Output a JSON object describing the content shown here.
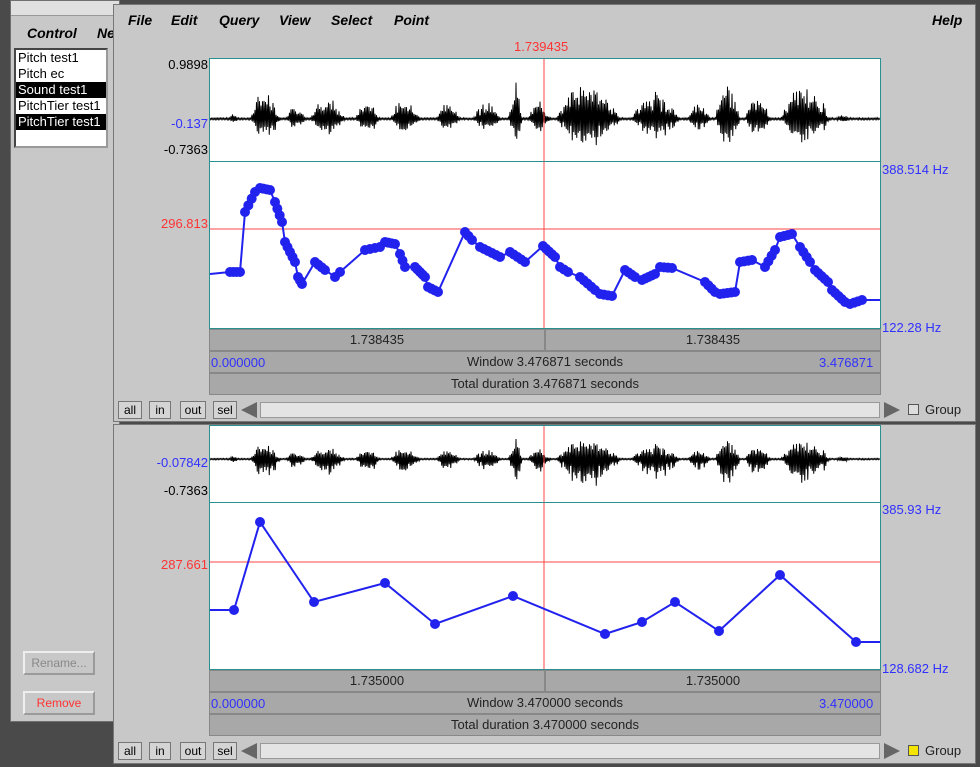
{
  "object_window": {
    "menu": [
      "Control",
      "Ne"
    ],
    "objects": [
      {
        "label": "Pitch test1",
        "selected": false
      },
      {
        "label": "Pitch ec",
        "selected": false
      },
      {
        "label": "Sound test1",
        "selected": true
      },
      {
        "label": "PitchTier test1",
        "selected": false
      },
      {
        "label": "PitchTier test1",
        "selected": true
      }
    ],
    "rename_label": "Rename...",
    "remove_label": "Remove"
  },
  "editor1": {
    "menu": [
      "File",
      "Edit",
      "Query",
      "View",
      "Select",
      "Point"
    ],
    "help": "Help",
    "cursor_time": "1.739435",
    "sound_max": "0.9898",
    "sound_mid": "-0.137",
    "sound_min": "-0.7363",
    "pitch_top": "388.514 Hz",
    "pitch_bottom": "122.28 Hz",
    "pitch_cursor": "296.813",
    "left_half": "1.738435",
    "right_half": "1.738435",
    "window_start": "0.000000",
    "window_text": "Window 3.476871 seconds",
    "window_end": "3.476871",
    "total_text": "Total duration 3.476871 seconds",
    "buttons": [
      "all",
      "in",
      "out",
      "sel"
    ],
    "group_label": "Group"
  },
  "editor2": {
    "sound_mid": "-0.07842",
    "sound_min": "-0.7363",
    "pitch_top": "385.93 Hz",
    "pitch_bottom": "128.682 Hz",
    "pitch_cursor": "287.661",
    "left_half": "1.735000",
    "right_half": "1.735000",
    "window_start": "0.000000",
    "window_text": "Window 3.470000 seconds",
    "window_end": "3.470000",
    "total_text": "Total duration 3.470000 seconds",
    "buttons": [
      "all",
      "in",
      "out",
      "sel"
    ],
    "group_label": "Group"
  },
  "colors": {
    "pitch": "#2222ee",
    "cursor": "#ff4444",
    "frame": "#2a8f8f"
  }
}
